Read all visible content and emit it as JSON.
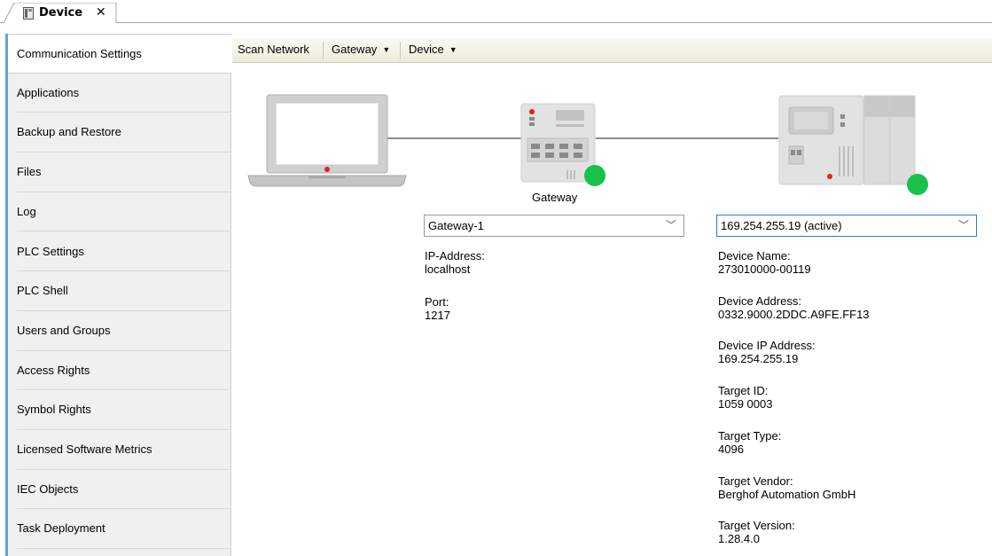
{
  "tab": {
    "title": "Device",
    "close": "✕"
  },
  "sidebar": {
    "items": [
      {
        "label": "Communication Settings"
      },
      {
        "label": "Applications"
      },
      {
        "label": "Backup and Restore"
      },
      {
        "label": "Files"
      },
      {
        "label": "Log"
      },
      {
        "label": "PLC Settings"
      },
      {
        "label": "PLC Shell"
      },
      {
        "label": "Users and Groups"
      },
      {
        "label": "Access Rights"
      },
      {
        "label": "Symbol Rights"
      },
      {
        "label": "Licensed Software Metrics"
      },
      {
        "label": "IEC Objects"
      },
      {
        "label": "Task Deployment"
      }
    ]
  },
  "toolbar": {
    "scan": "Scan Network",
    "gateway": "Gateway",
    "device": "Device"
  },
  "gateway": {
    "caption": "Gateway",
    "selected": "Gateway-1",
    "ip_label": "IP-Address:",
    "ip_value": "localhost",
    "port_label": "Port:",
    "port_value": "1217"
  },
  "device": {
    "selected": "169.254.255.19 (active)",
    "fields": [
      {
        "label": "Device Name:",
        "value": "273010000-00119"
      },
      {
        "label": "Device Address:",
        "value": "0332.9000.2DDC.A9FE.FF13"
      },
      {
        "label": "Device IP Address:",
        "value": "169.254.255.19"
      },
      {
        "label": "Target ID:",
        "value": "1059  0003"
      },
      {
        "label": "Target Type:",
        "value": "4096"
      },
      {
        "label": "Target Vendor:",
        "value": "Berghof Automation GmbH"
      },
      {
        "label": "Target Version:",
        "value": "1.28.4.0"
      }
    ]
  },
  "colors": {
    "status_ok": "#16c24a",
    "accent": "#6aa0d8",
    "focus": "#2d7bd2"
  }
}
